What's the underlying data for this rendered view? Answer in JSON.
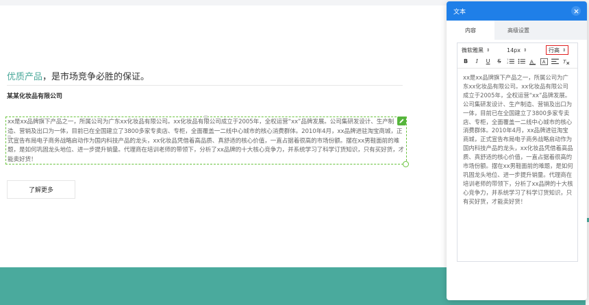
{
  "page": {
    "headline_accent": "优质产品",
    "headline_rest": "，是市场竞争必胜的保证。",
    "company": "某某化妆品有限公司",
    "paragraph": "xx是xx品牌旗下产品之一，所属公司为广东xx化妆品有限公司。xx化妆品有限公司成立于2005年，全权运营“xx”品牌发展。公司集研发设计、生产制造、营销及出口为一体，目前已在全国建立了3800多家专卖店、专柜，全面覆盖一二线中心城市的核心消费群体。2010年4月，xx品牌进驻淘宝商城，正式宣告布局电子商务战略启动作为国内科技产品的龙头，xx化妆品凭借着高品质、真舒适的核心价值，一直占据着很高的市场份额。摆在xx男鞋面前的难题，是如何巩固龙头地位、进一步提升销量。代理商在培训老师的带领下，分析了xx品牌的十大核心竞争力，并系统学习了科学订货知识，只有买好货，才能卖好货！",
    "more_button": "了解更多"
  },
  "panel": {
    "title": "文本",
    "tabs": [
      "内容",
      "高级设置"
    ],
    "active_tab": "内容",
    "toolbar": {
      "font": "微软雅黑",
      "size": "14px",
      "line_height": "行高",
      "tools": [
        "B",
        "I",
        "U",
        "S",
        "ordered-list",
        "unordered-list",
        "A",
        "A-highlight",
        "align",
        "clear-format"
      ]
    },
    "editor_text": "xx是xx品牌旗下产品之一，所属公司为广东xx化妆品有限公司。xx化妆品有限公司成立于2005年，全权运营“xx”品牌发展。公司集研发设计、生产制造、营销及出口为一体，目前已在全国建立了3800多家专卖店、专柜，全面覆盖一二线中心城市的核心消费群体。2010年4月，xx品牌进驻淘宝商城，正式宣告布局电子商务战略启动作为国内科技产品的龙头，xx化妆品凭借着高品质、真舒适的核心价值，一直占据着很高的市场份额。摆在xx男鞋面前的难题，是如何巩固龙头地位、进一步提升销量。代理商在培训老师的带领下，分析了xx品牌的十大核心竞争力，并系统学习了科学订货知识，只有买好货，才能卖好货！"
  },
  "colors": {
    "accent": "#4aa89a",
    "panel_header": "#1f7fe8",
    "selection": "#67c23a",
    "footer": "#4aaa9d",
    "highlight_border": "#e02020"
  }
}
